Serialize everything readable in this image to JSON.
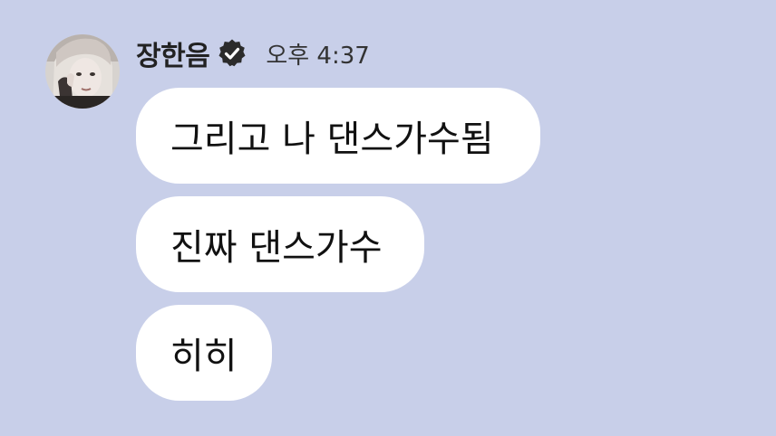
{
  "header": {
    "sender_name": "장한음",
    "timestamp": "오후 4:37"
  },
  "icons": {
    "verified": "verified-badge-icon",
    "avatar": "profile-photo"
  },
  "colors": {
    "background": "#c8cfe9",
    "bubble": "#ffffff",
    "text": "#111111"
  },
  "messages": [
    {
      "text": "그리고 나 댄스가수됨"
    },
    {
      "text": "진짜 댄스가수"
    },
    {
      "text": "히히"
    }
  ]
}
